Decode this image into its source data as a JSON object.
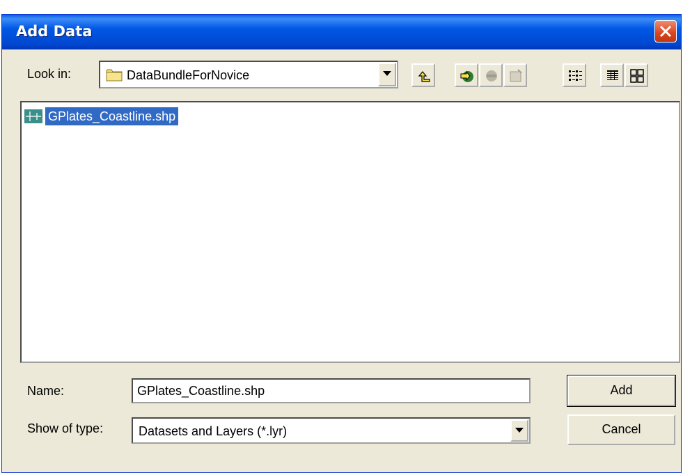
{
  "window": {
    "title": "Add Data",
    "close_icon": "close-icon"
  },
  "lookin": {
    "label": "Look in:",
    "value": "DataBundleForNovice",
    "icon": "folder-icon"
  },
  "toolbar": {
    "buttons": [
      {
        "name": "up-one-level-icon"
      },
      {
        "name": "connect-to-folder-icon"
      },
      {
        "name": "disconnect-folder-icon",
        "disabled": true
      },
      {
        "name": "new-item-icon",
        "disabled": true
      },
      {
        "name": "list-view-icon",
        "active": true
      },
      {
        "name": "details-view-icon"
      },
      {
        "name": "thumbnails-view-icon"
      }
    ]
  },
  "files": [
    {
      "name": "GPlates_Coastline.shp",
      "icon": "shapefile-icon",
      "selected": true
    }
  ],
  "form": {
    "name_label": "Name:",
    "name_value": "GPlates_Coastline.shp",
    "type_label": "Show of type:",
    "type_value": "Datasets and Layers (*.lyr)"
  },
  "buttons": {
    "add": "Add",
    "cancel": "Cancel"
  },
  "colors": {
    "titlebar": "#0058e6",
    "selection": "#316ac5",
    "dialog_bg": "#ece9d8"
  }
}
